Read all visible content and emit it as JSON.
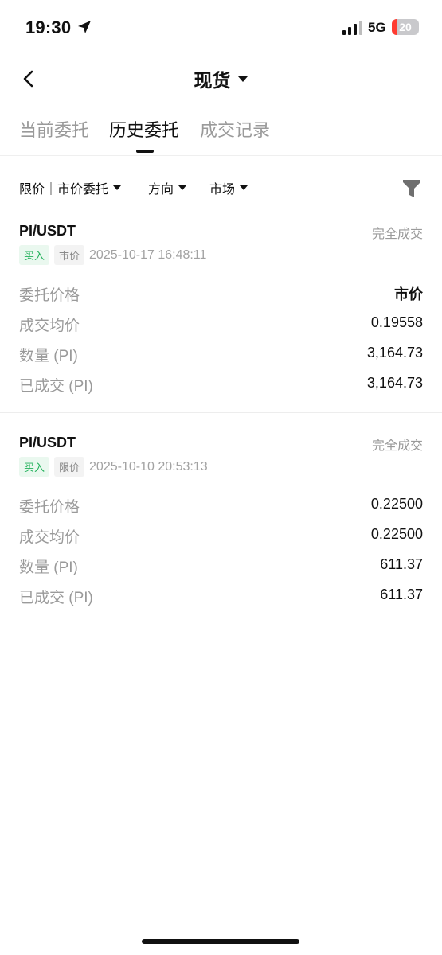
{
  "status_bar": {
    "time": "19:30",
    "network": "5G",
    "battery_level": "20",
    "battery_fraction": 0.2,
    "battery_color": "#ff3b30"
  },
  "header": {
    "title": "现货"
  },
  "tabs": [
    {
      "label": "当前委托",
      "active": false
    },
    {
      "label": "历史委托",
      "active": true
    },
    {
      "label": "成交记录",
      "active": false
    }
  ],
  "filters": {
    "order_type": "限价｜市价委托",
    "direction": "方向",
    "market": "市场"
  },
  "orders": [
    {
      "pair": "PI/USDT",
      "status": "完全成交",
      "side": "买入",
      "type": "市价",
      "time": "2025-10-17 16:48:11",
      "rows": [
        {
          "label": "委托价格",
          "value": "市价"
        },
        {
          "label": "成交均价",
          "value": "0.19558"
        },
        {
          "label": "数量 (PI)",
          "value": "3,164.73"
        },
        {
          "label": "已成交 (PI)",
          "value": "3,164.73"
        }
      ]
    },
    {
      "pair": "PI/USDT",
      "status": "完全成交",
      "side": "买入",
      "type": "限价",
      "time": "2025-10-10 20:53:13",
      "rows": [
        {
          "label": "委托价格",
          "value": "0.22500"
        },
        {
          "label": "成交均价",
          "value": "0.22500"
        },
        {
          "label": "数量 (PI)",
          "value": "611.37"
        },
        {
          "label": "已成交 (PI)",
          "value": "611.37"
        }
      ]
    }
  ],
  "colors": {
    "buy_green": "#21b15a",
    "muted_text": "#9a9a9a"
  }
}
